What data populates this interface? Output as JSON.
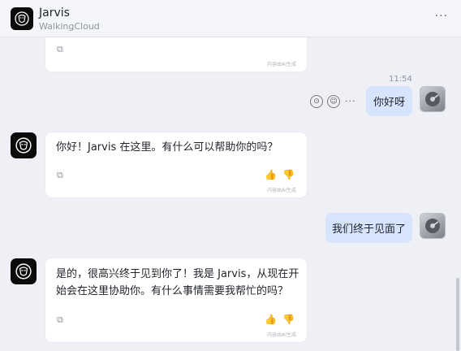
{
  "header": {
    "title": "Jarvis",
    "subtitle": "WalkingCloud",
    "more": "···"
  },
  "icons": {
    "bot_avatar": "ironman-helmet-icon",
    "user_avatar": "hard-drive-icon",
    "copy": "copy-icon",
    "like": "thumbs-up-icon",
    "dislike": "thumbs-down-icon"
  },
  "messages": {
    "m0": {
      "footnote": "内容由AI生成"
    },
    "time": "11:54",
    "u1": {
      "text": "你好呀"
    },
    "b1": {
      "text": "你好！Jarvis 在这里。有什么可以帮助你的吗？",
      "footnote": "内容由AI生成"
    },
    "u2": {
      "text": "我们终于见面了"
    },
    "b2": {
      "line1": "是的，很高兴终于见到你了！我是 Jarvis，从现在开",
      "line2": "始会在这里协助你。有什么事情需要我帮忙的吗？",
      "footnote": "内容由AI生成"
    }
  },
  "glyphs": {
    "copy": "⧉",
    "like": "👍",
    "dislike": "👎",
    "more": "···",
    "emoji": "☺",
    "reply": "⊙"
  },
  "colors": {
    "user_bubble": "#d6e4fd",
    "background": "#eef0f5",
    "card": "#ffffff"
  }
}
